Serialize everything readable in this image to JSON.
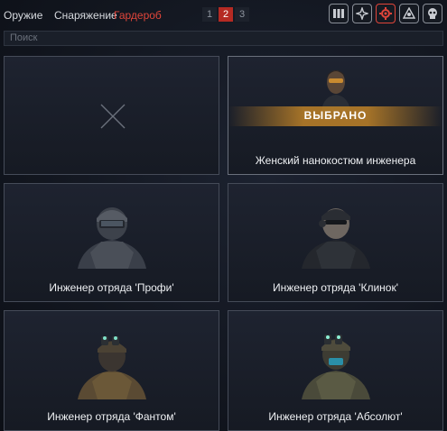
{
  "tabs": [
    {
      "label": "Оружие"
    },
    {
      "label": "Снаряжение"
    },
    {
      "label": "Гардероб",
      "active": true
    }
  ],
  "pages": [
    "1",
    "2",
    "3"
  ],
  "active_page": "2",
  "toolbar_icons": [
    "ammo-icon",
    "medic-icon",
    "engineer-icon",
    "sniper-icon",
    "skull-icon"
  ],
  "search": {
    "placeholder": "Поиск"
  },
  "cards": [
    {
      "label": "",
      "empty": true
    },
    {
      "label": "Женский нанокостюм инженера",
      "selected": true,
      "badge": "ВЫБРАНО"
    },
    {
      "label": "Инженер отряда 'Профи'"
    },
    {
      "label": "Инженер отряда 'Клинок'"
    },
    {
      "label": "Инженер отряда 'Фантом'"
    },
    {
      "label": "Инженер отряда 'Абсолют'"
    }
  ],
  "colors": {
    "accent": "#e0453a",
    "selected_banner": "#be822a"
  }
}
